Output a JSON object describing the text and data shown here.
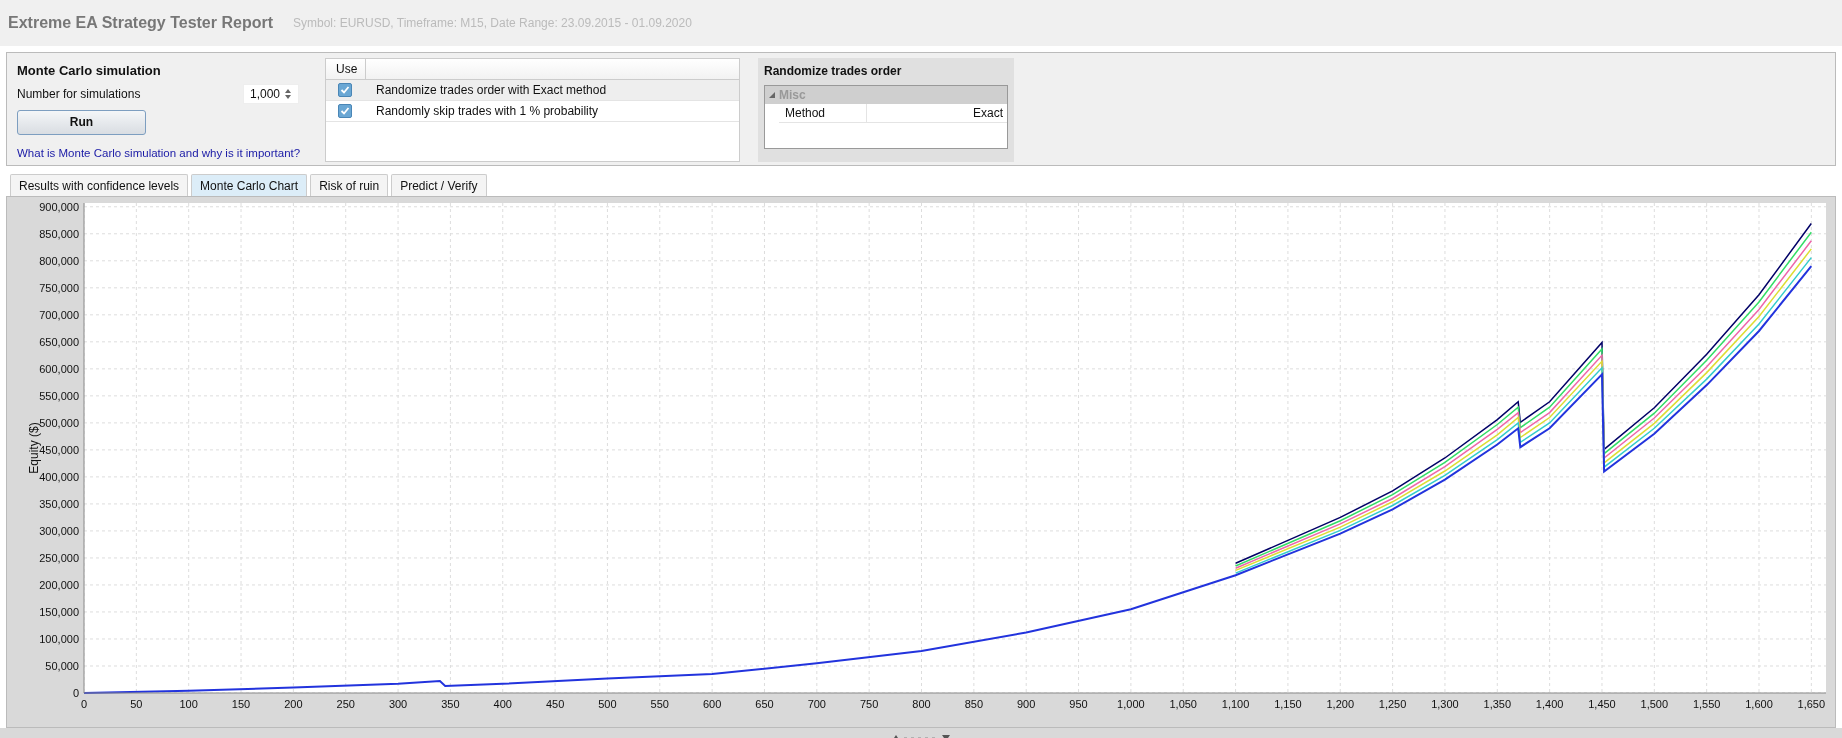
{
  "header": {
    "title": "Extreme EA Strategy Tester Report",
    "subtitle": "Symbol: EURUSD, Timeframe: M15, Date Range: 23.09.2015 - 01.09.2020"
  },
  "simulation": {
    "title": "Monte Carlo simulation",
    "count_label": "Number for simulations",
    "count_value": "1,000",
    "run_button": "Run",
    "help_link": "What is Monte Carlo simulation and why is it important?"
  },
  "options": {
    "column": "Use",
    "rows": [
      {
        "label": "Randomize trades order with Exact method",
        "checked": true,
        "selected": true
      },
      {
        "label": "Randomly skip trades with 1 % probability",
        "checked": true,
        "selected": false
      }
    ]
  },
  "properties": {
    "title": "Randomize trades order",
    "category": "Misc",
    "expanded": true,
    "rows": [
      {
        "name": "Method",
        "value": "Exact"
      }
    ]
  },
  "tabs": [
    {
      "label": "Results with confidence levels",
      "selected": false
    },
    {
      "label": "Monte Carlo Chart",
      "selected": true
    },
    {
      "label": "Risk of ruin",
      "selected": false
    },
    {
      "label": "Predict / Verify",
      "selected": false
    }
  ],
  "chart_data": {
    "type": "line",
    "ylabel": "Equity ($)",
    "xlim": [
      0,
      1664
    ],
    "ylim": [
      0,
      907000
    ],
    "xticks": [
      {
        "value": 0,
        "label": "0"
      },
      {
        "value": 50,
        "label": "50"
      },
      {
        "value": 100,
        "label": "100"
      },
      {
        "value": 150,
        "label": "150"
      },
      {
        "value": 200,
        "label": "200"
      },
      {
        "value": 250,
        "label": "250"
      },
      {
        "value": 300,
        "label": "300"
      },
      {
        "value": 350,
        "label": "350"
      },
      {
        "value": 400,
        "label": "400"
      },
      {
        "value": 450,
        "label": "450"
      },
      {
        "value": 500,
        "label": "500"
      },
      {
        "value": 550,
        "label": "550"
      },
      {
        "value": 600,
        "label": "600"
      },
      {
        "value": 650,
        "label": "650"
      },
      {
        "value": 700,
        "label": "700"
      },
      {
        "value": 750,
        "label": "750"
      },
      {
        "value": 800,
        "label": "800"
      },
      {
        "value": 850,
        "label": "850"
      },
      {
        "value": 900,
        "label": "900"
      },
      {
        "value": 950,
        "label": "950"
      },
      {
        "value": 1000,
        "label": "1,000"
      },
      {
        "value": 1050,
        "label": "1,050"
      },
      {
        "value": 1100,
        "label": "1,100"
      },
      {
        "value": 1150,
        "label": "1,150"
      },
      {
        "value": 1200,
        "label": "1,200"
      },
      {
        "value": 1250,
        "label": "1,250"
      },
      {
        "value": 1300,
        "label": "1,300"
      },
      {
        "value": 1350,
        "label": "1,350"
      },
      {
        "value": 1400,
        "label": "1,400"
      },
      {
        "value": 1450,
        "label": "1,450"
      },
      {
        "value": 1500,
        "label": "1,500"
      },
      {
        "value": 1550,
        "label": "1,550"
      },
      {
        "value": 1600,
        "label": "1,600"
      },
      {
        "value": 1650,
        "label": "1,650"
      }
    ],
    "yticks": [
      {
        "value": 0,
        "label": "0"
      },
      {
        "value": 50000,
        "label": "50,000"
      },
      {
        "value": 100000,
        "label": "100,000"
      },
      {
        "value": 150000,
        "label": "150,000"
      },
      {
        "value": 200000,
        "label": "200,000"
      },
      {
        "value": 250000,
        "label": "250,000"
      },
      {
        "value": 300000,
        "label": "300,000"
      },
      {
        "value": 350000,
        "label": "350,000"
      },
      {
        "value": 400000,
        "label": "400,000"
      },
      {
        "value": 450000,
        "label": "450,000"
      },
      {
        "value": 500000,
        "label": "500,000"
      },
      {
        "value": 550000,
        "label": "550,000"
      },
      {
        "value": 600000,
        "label": "600,000"
      },
      {
        "value": 650000,
        "label": "650,000"
      },
      {
        "value": 700000,
        "label": "700,000"
      },
      {
        "value": 750000,
        "label": "750,000"
      },
      {
        "value": 800000,
        "label": "800,000"
      },
      {
        "value": 850000,
        "label": "850,000"
      },
      {
        "value": 900000,
        "label": "900,000"
      }
    ],
    "x": [
      0,
      100,
      200,
      300,
      340,
      345,
      400,
      500,
      600,
      700,
      800,
      900,
      1000,
      1100,
      1200,
      1250,
      1300,
      1350,
      1370,
      1372,
      1400,
      1450,
      1452,
      1500,
      1550,
      1600,
      1650
    ],
    "grid": true,
    "series": [
      {
        "color": "#000066",
        "values": [
          null,
          null,
          null,
          null,
          null,
          null,
          null,
          null,
          null,
          null,
          null,
          null,
          null,
          240000,
          325000,
          374000,
          435000,
          506000,
          539000,
          501000,
          539000,
          649000,
          451000,
          528000,
          627000,
          737000,
          869000
        ]
      },
      {
        "color": "#33dd66",
        "values": [
          null,
          null,
          null,
          null,
          null,
          null,
          null,
          null,
          null,
          null,
          null,
          null,
          null,
          235000,
          319000,
          367000,
          427000,
          497000,
          529000,
          491000,
          529000,
          637000,
          443000,
          518000,
          616000,
          724000,
          853000
        ]
      },
      {
        "color": "#ee66aa",
        "values": [
          null,
          null,
          null,
          null,
          null,
          null,
          null,
          null,
          null,
          null,
          null,
          null,
          null,
          231000,
          313000,
          360000,
          419000,
          488000,
          519000,
          482000,
          519000,
          625000,
          435000,
          509000,
          604000,
          710000,
          837000
        ]
      },
      {
        "color": "#dddd33",
        "values": [
          null,
          null,
          null,
          null,
          null,
          null,
          null,
          null,
          null,
          null,
          null,
          null,
          null,
          227000,
          307000,
          354000,
          411000,
          478000,
          510000,
          473000,
          510000,
          614000,
          426000,
          499000,
          593000,
          697000,
          822000
        ]
      },
      {
        "color": "#33cccc",
        "values": [
          null,
          null,
          null,
          null,
          null,
          null,
          null,
          null,
          null,
          null,
          null,
          null,
          null,
          222000,
          301000,
          347000,
          403000,
          469000,
          500000,
          464000,
          500000,
          602000,
          418000,
          490000,
          581000,
          683000,
          806000
        ]
      },
      {
        "color": "#2233dd",
        "values": [
          0,
          4000,
          10000,
          17000,
          22000,
          13000,
          17000,
          27000,
          35000,
          55000,
          78000,
          112000,
          155000,
          218000,
          295000,
          340000,
          395000,
          460000,
          490000,
          455000,
          490000,
          590000,
          410000,
          480000,
          570000,
          670000,
          790000
        ]
      }
    ]
  }
}
